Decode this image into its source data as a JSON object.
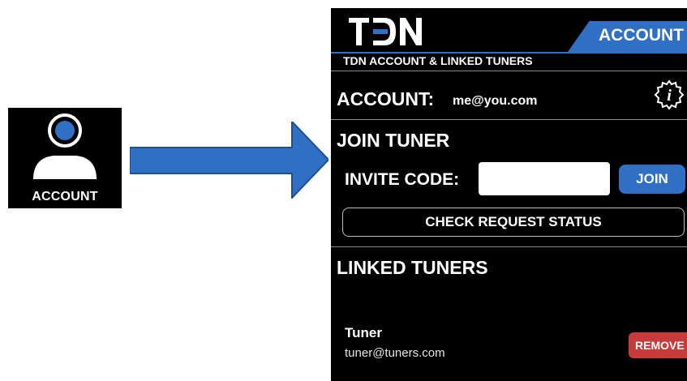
{
  "tile": {
    "label": "ACCOUNT",
    "icon": "user-icon"
  },
  "arrow": {
    "icon": "arrow-right-icon"
  },
  "header": {
    "logo_text": "TDN",
    "tab_label": "ACCOUNT",
    "subtitle": "TDN ACCOUNT & LINKED TUNERS"
  },
  "account": {
    "label": "ACCOUNT:",
    "email": "me@you.com",
    "info_icon": "info-icon"
  },
  "join": {
    "title": "JOIN TUNER",
    "invite_label": "INVITE CODE:",
    "invite_value": "",
    "join_label": "JOIN",
    "check_label": "CHECK REQUEST STATUS"
  },
  "linked": {
    "title": "LINKED TUNERS",
    "tuners": [
      {
        "name": "Tuner",
        "email": "tuner@tuners.com",
        "remove_label": "REMOVE"
      }
    ]
  },
  "colors": {
    "accent": "#2f6fc4",
    "danger": "#c93a3a",
    "background": "#000000"
  }
}
